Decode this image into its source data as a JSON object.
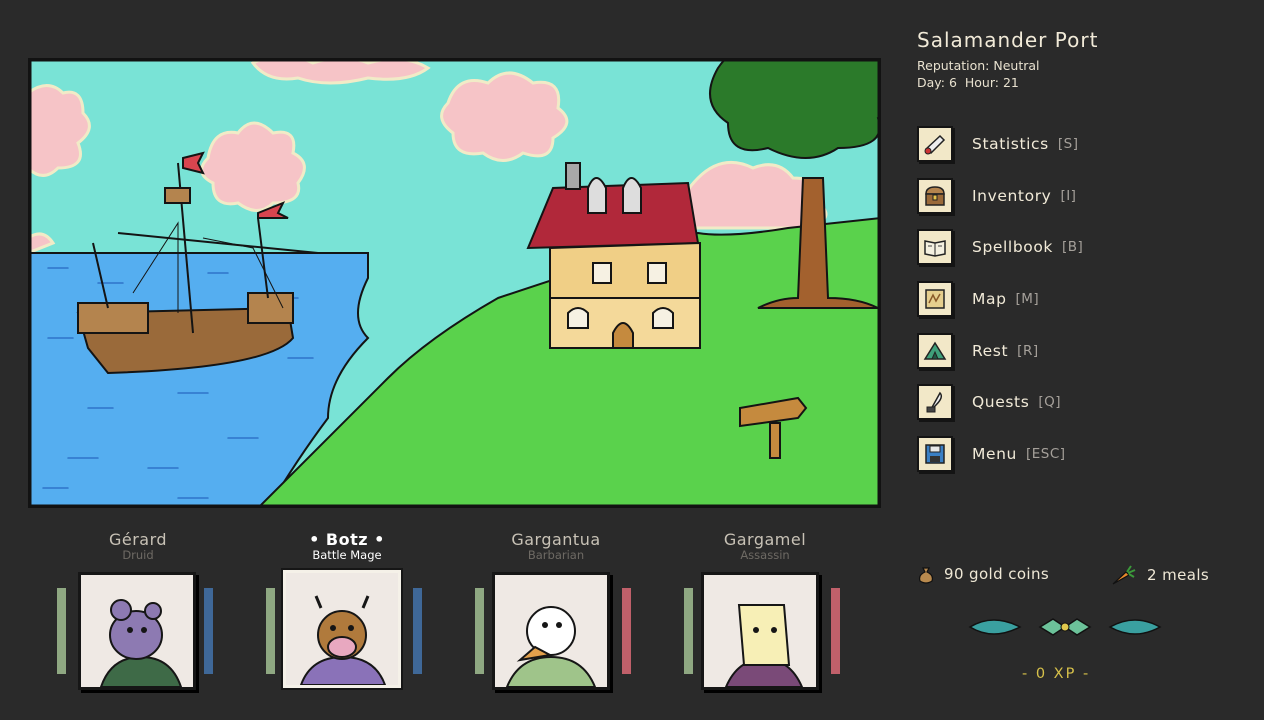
{
  "location": {
    "name": "Salamander Port",
    "reputation": "Reputation: Neutral",
    "day": "Day: 6",
    "hour": "Hour: 21"
  },
  "menu": [
    {
      "label": "Statistics",
      "key": "[S]",
      "icon": "scroll-icon"
    },
    {
      "label": "Inventory",
      "key": "[I]",
      "icon": "chest-icon"
    },
    {
      "label": "Spellbook",
      "key": "[B]",
      "icon": "spellbook-icon"
    },
    {
      "label": "Map",
      "key": "[M]",
      "icon": "map-icon"
    },
    {
      "label": "Rest",
      "key": "[R]",
      "icon": "tent-icon"
    },
    {
      "label": "Quests",
      "key": "[Q]",
      "icon": "quill-icon"
    },
    {
      "label": "Menu",
      "key": "[ESC]",
      "icon": "floppy-disk-icon"
    }
  ],
  "party": [
    {
      "name": "Gérard",
      "class": "Druid",
      "portrait": "rat-druid-portrait",
      "active": false
    },
    {
      "name": "• Botz •",
      "class": "Battle Mage",
      "portrait": "cow-battle-mage-portrait",
      "active": true
    },
    {
      "name": "Gargantua",
      "class": "Barbarian",
      "portrait": "bird-barbarian-portrait",
      "active": false
    },
    {
      "name": "Gargamel",
      "class": "Assassin",
      "portrait": "dog-assassin-portrait",
      "active": false
    }
  ],
  "resources": {
    "gold": "90 gold coins",
    "meals": "2 meals",
    "xp": "- 0 XP -"
  },
  "colors": {
    "background": "#2a2a2a",
    "health_bar": "#8fa882",
    "mana_bar": "#3f6898",
    "rage_bar": "#c0606a",
    "xp_text": "#d7c14a"
  }
}
